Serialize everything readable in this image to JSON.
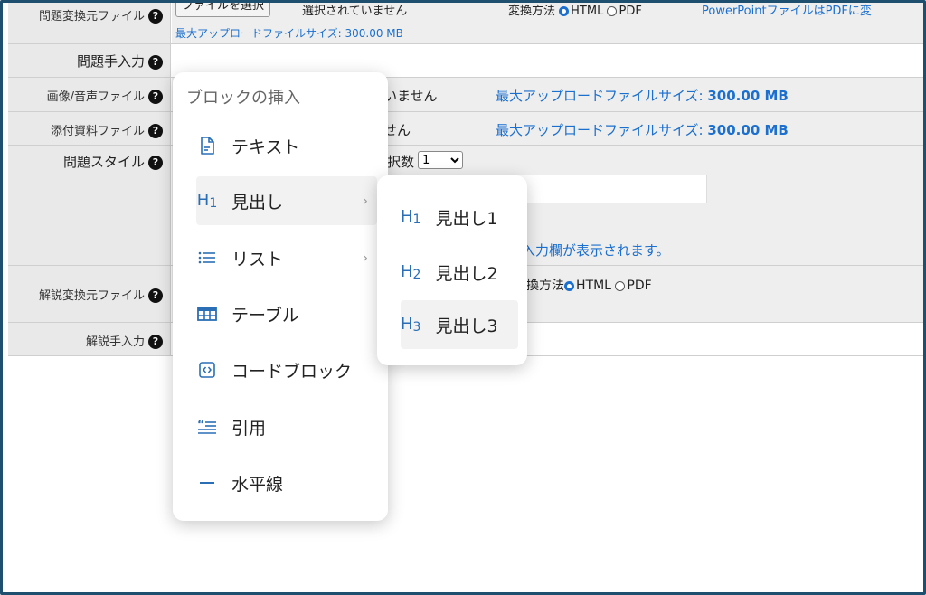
{
  "form": {
    "rows": [
      {
        "label": "問題変換元ファイル"
      },
      {
        "label": "問題手入力"
      },
      {
        "label": "画像/音声ファイル"
      },
      {
        "label": "添付資料ファイル"
      },
      {
        "label": "問題スタイル"
      },
      {
        "label": "解説変換元ファイル"
      },
      {
        "label": "解説手入力"
      }
    ],
    "help_icon": "?",
    "file_button": "ファイルを選択",
    "file_status_partial1": "選択されていません",
    "file_status_partial2": "いません",
    "file_status_partial3": "せん",
    "max_upload_small": "最大アップロードファイルサイズ: 300.00 MB",
    "max_upload_label": "最大アップロードファイルサイズ: ",
    "max_upload_value": "300.00 MB",
    "convert_method_top": "変換方法",
    "html_label": "HTML",
    "pdf_label": "PDF",
    "top_link_partial": "PowerPointファイルはPDFに変",
    "choice_count_label": "択数",
    "choice_count_value": "1",
    "input_notice_partial": "ト入力欄が表示されます。",
    "convert_method_partial": "換方法"
  },
  "block_menu": {
    "title": "ブロックの挿入",
    "items": [
      {
        "label": "テキスト",
        "icon": "document-icon"
      },
      {
        "label": "見出し",
        "icon": "heading-icon"
      },
      {
        "label": "リスト",
        "icon": "list-icon"
      },
      {
        "label": "テーブル",
        "icon": "table-icon"
      },
      {
        "label": "コードブロック",
        "icon": "code-icon"
      },
      {
        "label": "引用",
        "icon": "quote-icon"
      },
      {
        "label": "水平線",
        "icon": "horizontal-rule-icon"
      }
    ],
    "chevron": "›"
  },
  "heading_submenu": {
    "items": [
      {
        "icon_text": "H",
        "level": "1",
        "label": "見出し1"
      },
      {
        "icon_text": "H",
        "level": "2",
        "label": "見出し2"
      },
      {
        "icon_text": "H",
        "level": "3",
        "label": "見出し3"
      }
    ]
  },
  "colors": {
    "accent": "#1a6fcf",
    "frame": "#1e4f6e",
    "icon": "#2a6fb6"
  }
}
